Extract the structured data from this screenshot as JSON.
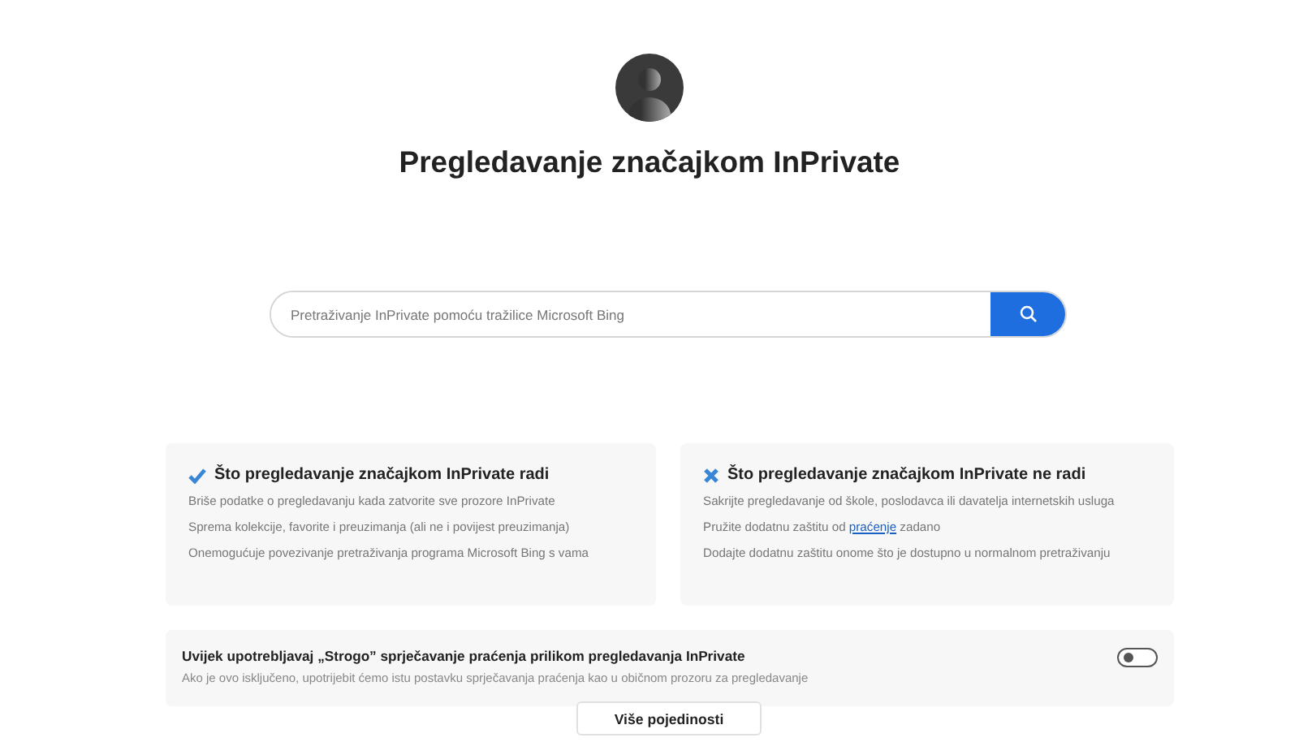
{
  "title": "Pregledavanje značajkom InPrivate",
  "search": {
    "placeholder": "Pretraživanje InPrivate pomoću tražilice Microsoft Bing"
  },
  "cards": [
    {
      "kind": "check",
      "heading": "Što pregledavanje značajkom InPrivate radi",
      "items": [
        {
          "text": "Briše podatke o pregledavanju kada zatvorite sve prozore InPrivate"
        },
        {
          "text": "Sprema kolekcije, favorite i preuzimanja (ali ne i povijest preuzimanja)"
        },
        {
          "text": "Onemogućuje povezivanje pretraživanja programa Microsoft Bing s vama"
        }
      ]
    },
    {
      "kind": "cross",
      "heading": "Što pregledavanje značajkom InPrivate ne radi",
      "items": [
        {
          "text": "Sakrijte pregledavanje od škole, poslodavca ili davatelja internetskih usluga"
        },
        {
          "text": "Pružite dodatnu zaštitu od ",
          "link": "praćenje",
          "after": " zadano"
        },
        {
          "text": "Dodajte dodatnu zaštitu onome što je dostupno u normalnom pretraživanju"
        }
      ]
    }
  ],
  "setting": {
    "label": "Uvijek upotrebljavaj „Strogo” sprječavanje praćenja prilikom pregledavanja InPrivate",
    "description": "Ako je ovo isključeno, upotrijebit ćemo istu postavku sprječavanja praćenja kao u običnom prozoru za pregledavanje",
    "on": false
  },
  "more_button": "Više pojedinosti"
}
